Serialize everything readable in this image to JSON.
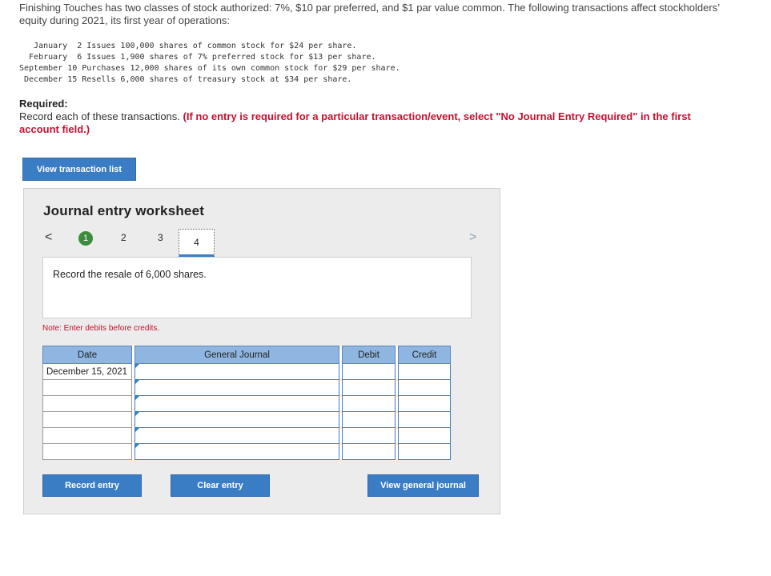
{
  "intro": "Finishing Touches has two classes of stock authorized: 7%, $10 par preferred, and $1 par value common. The following transactions affect stockholders’ equity during 2021, its first year of operations:",
  "transactions": [
    "   January  2 Issues 100,000 shares of common stock for $24 per share.",
    "  February  6 Issues 1,900 shares of 7% preferred stock for $13 per share.",
    "September 10 Purchases 12,000 shares of its own common stock for $29 per share.",
    " December 15 Resells 6,000 shares of treasury stock at $34 per share."
  ],
  "required": {
    "heading": "Required:",
    "text": "Record each of these transactions. ",
    "instruction": "(If no entry is required for a particular transaction/event, select \"No Journal Entry Required\" in the first account field.)"
  },
  "buttons": {
    "view_transaction_list": "View transaction list",
    "record_entry": "Record entry",
    "clear_entry": "Clear entry",
    "view_general_journal": "View general journal"
  },
  "worksheet": {
    "title": "Journal entry worksheet",
    "nav_prev": "<",
    "nav_next": ">",
    "steps": [
      "1",
      "2",
      "3",
      "4"
    ],
    "current_step": "4",
    "description": "Record the resale of 6,000 shares.",
    "note": "Note: Enter debits before credits.",
    "columns": {
      "date": "Date",
      "journal": "General Journal",
      "debit": "Debit",
      "credit": "Credit"
    },
    "rows": [
      {
        "date": "December 15, 2021",
        "account": "",
        "debit": "",
        "credit": ""
      },
      {
        "date": "",
        "account": "",
        "debit": "",
        "credit": ""
      },
      {
        "date": "",
        "account": "",
        "debit": "",
        "credit": ""
      },
      {
        "date": "",
        "account": "",
        "debit": "",
        "credit": ""
      },
      {
        "date": "",
        "account": "",
        "debit": "",
        "credit": ""
      },
      {
        "date": "",
        "account": "",
        "debit": "",
        "credit": ""
      }
    ]
  },
  "colors": {
    "accent": "#3b7dc4",
    "header_fill": "#8eb6e0",
    "complete": "#3d8b3d",
    "instruction_red": "#c8102e"
  }
}
